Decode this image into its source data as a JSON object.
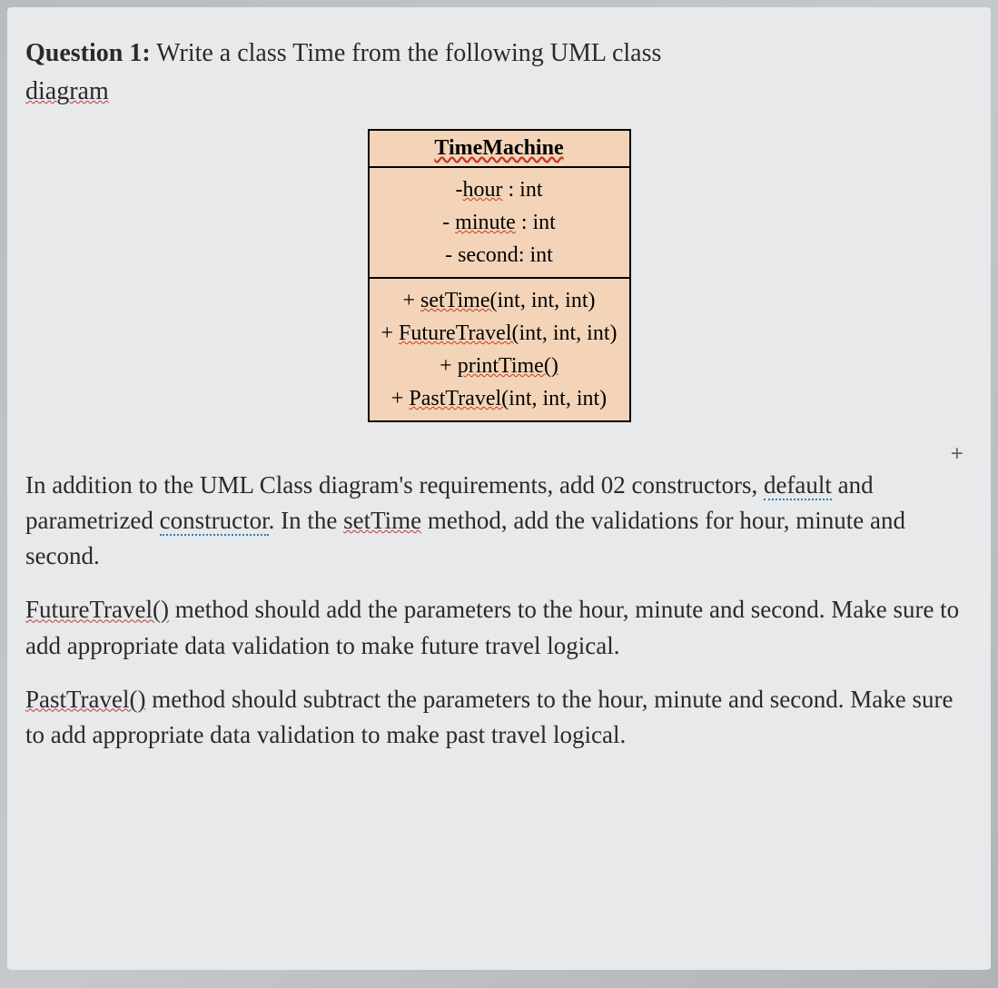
{
  "question": {
    "label": "Question 1:",
    "text": " Write a class Time from the following UML class ",
    "text2": "diagram"
  },
  "uml": {
    "className": "TimeMachine",
    "attributes": [
      {
        "prefix": "-",
        "name": "hour",
        "suffix": " : int"
      },
      {
        "prefix": "- ",
        "name": "minute",
        "suffix": " : int"
      },
      {
        "prefix": "- ",
        "name": "second",
        "suffix": ": int",
        "plain": true
      }
    ],
    "methods": [
      {
        "text": "+ ",
        "name": "setTime(",
        "suffix": "int, int, int)"
      },
      {
        "text": "+ ",
        "name": "FutureTravel(",
        "suffix": "int, int, int)"
      },
      {
        "text": "+ ",
        "name": "printTime()",
        "suffix": ""
      },
      {
        "text": "+ ",
        "name": "PastTravel(",
        "suffix": "int, int, int)"
      }
    ]
  },
  "para1": {
    "line1": "In addition to the UML Class diagram's requirements, add 02 constructors, ",
    "default": "default",
    "mid1": " and parametrized ",
    "constructor": "constructor",
    "mid2": ". In the ",
    "setTime": "setTime",
    "end": " method, add the validations for hour, minute and second."
  },
  "para2": {
    "futureTravel": "FutureTravel()",
    "rest": " method should add the parameters to the hour, minute and second. Make sure to add appropriate data validation to make future travel logical."
  },
  "para3": {
    "pastTravel": "PastTravel()",
    "rest": " method should subtract the parameters to the hour, minute and second. Make sure to add appropriate data validation to make past travel logical."
  },
  "plusIcon": "+"
}
